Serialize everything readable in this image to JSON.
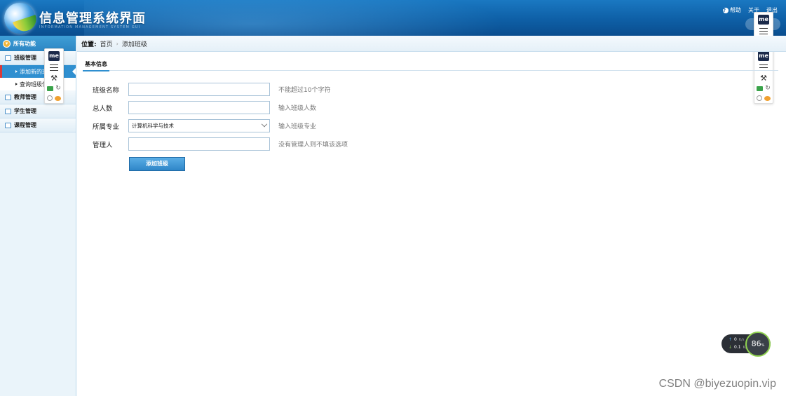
{
  "header": {
    "title": "信息管理系统界面",
    "subtitle": "INFORMATION MANAGEMENT SYSTEM GUI",
    "links": [
      "帮助",
      "关于",
      "退出"
    ]
  },
  "sidebar": {
    "head": "所有功能",
    "groups": [
      {
        "label": "班级管理",
        "items": [
          "添加新的班级",
          "查询班级信息"
        ]
      },
      {
        "label": "教师管理"
      },
      {
        "label": "学生管理"
      },
      {
        "label": "课程管理"
      }
    ]
  },
  "breadcrumb": {
    "label": "位置:",
    "home": "首页",
    "current": "添加班级"
  },
  "tab": "基本信息",
  "form": {
    "fields": [
      {
        "label": "班级名称",
        "value": "",
        "hint": "不能超过10个字符"
      },
      {
        "label": "总人数",
        "value": "",
        "hint": "输入班级人数"
      },
      {
        "label": "所属专业",
        "value": "计算机科学与技术",
        "hint": "输入班级专业"
      },
      {
        "label": "管理人",
        "value": "",
        "hint": "没有管理人则不填该选项"
      }
    ],
    "submit": "添加班级"
  },
  "floating_toolbar": {
    "logo": "me"
  },
  "net_monitor": {
    "up": "0",
    "up_unit": "K/s",
    "down": "0.1",
    "down_unit": "K/s",
    "percent": "86",
    "percent_unit": "%"
  },
  "watermark": "CSDN @biyezuopin.vip",
  "colors": {
    "header": "#0e5fa6",
    "accent": "#2f8fd0",
    "active_marker": "#d93a3a"
  }
}
